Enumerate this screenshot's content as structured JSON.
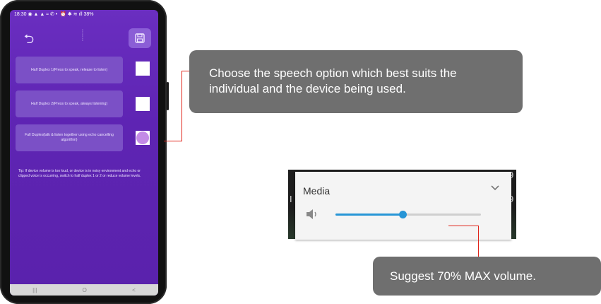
{
  "phone": {
    "status_time": "18:30",
    "status_battery": "38%",
    "options": [
      {
        "label": "Half Duplex 1(Press to speak, release to listen)",
        "selected": false
      },
      {
        "label": "Half Duplex 2(Press to speak, always listening)",
        "selected": false
      },
      {
        "label": "Full Duplex(talk & listen together using echo cancelling algorithm)",
        "selected": true
      }
    ],
    "tip": "Tip: If device volume is too loud, or device is in noisy environment and echo or clipped voice is occurring, switch to half duplex 1 or 2 or reduce volume levels.",
    "nav": [
      "|||",
      "O",
      "<"
    ]
  },
  "callouts": {
    "speech": "Choose the speech option which best suits the individual and the device being used.",
    "volume": "Suggest 70% MAX volume."
  },
  "media_panel": {
    "title": "Media",
    "volume_level": 0.46
  },
  "colors": {
    "app_purple": "#5e24b3",
    "callout_gray": "#6f6f6f",
    "connector_red": "#e0251b",
    "slider_blue": "#2795d6"
  }
}
